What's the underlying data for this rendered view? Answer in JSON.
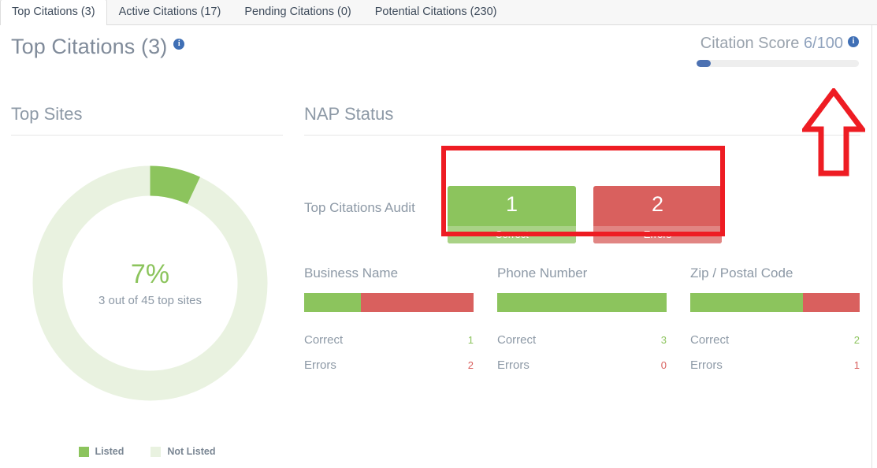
{
  "tabs": [
    {
      "label": "Top Citations (3)",
      "active": true
    },
    {
      "label": "Active Citations (17)",
      "active": false
    },
    {
      "label": "Pending Citations (0)",
      "active": false
    },
    {
      "label": "Potential Citations (230)",
      "active": false
    }
  ],
  "header": {
    "title": "Top Citations (3)",
    "info_icon": "info-icon",
    "score_label": "Citation Score",
    "score_value": "6/100",
    "score_percent": 6,
    "score_color": "#4c71b2"
  },
  "top_sites": {
    "heading": "Top Sites",
    "percent_text": "7%",
    "subtext": "3 out of 45 top sites",
    "legend": [
      {
        "label": "Listed",
        "color": "#8cc45d"
      },
      {
        "label": "Not Listed",
        "color": "#e9f2e0"
      }
    ]
  },
  "nap": {
    "heading": "NAP Status",
    "audit_label": "Top Citations Audit",
    "cards": [
      {
        "value": "1",
        "caption": "Correct",
        "color": "#8cc45d"
      },
      {
        "value": "2",
        "caption": "Errors",
        "color": "#d9605e"
      }
    ],
    "metrics": [
      {
        "title": "Business Name",
        "correct_label": "Correct",
        "correct_value": "1",
        "errors_label": "Errors",
        "errors_value": "2"
      },
      {
        "title": "Phone Number",
        "correct_label": "Correct",
        "correct_value": "3",
        "errors_label": "Errors",
        "errors_value": "0"
      },
      {
        "title": "Zip / Postal Code",
        "correct_label": "Correct",
        "correct_value": "2",
        "errors_label": "Errors",
        "errors_value": "1"
      }
    ]
  },
  "annotations": {
    "rectangle_color": "#ee1c23",
    "arrow_color": "#ee1c23"
  },
  "chart_data": {
    "type": "pie",
    "title": "Top Sites",
    "categories": [
      "Listed",
      "Not Listed"
    ],
    "values": [
      3,
      42
    ],
    "total": 45,
    "percent_listed": 7,
    "colors": [
      "#8cc45d",
      "#e9f2e0"
    ],
    "center_label": "7%",
    "center_sublabel": "3 out of 45 top sites",
    "legend_position": "bottom",
    "donut": true
  }
}
